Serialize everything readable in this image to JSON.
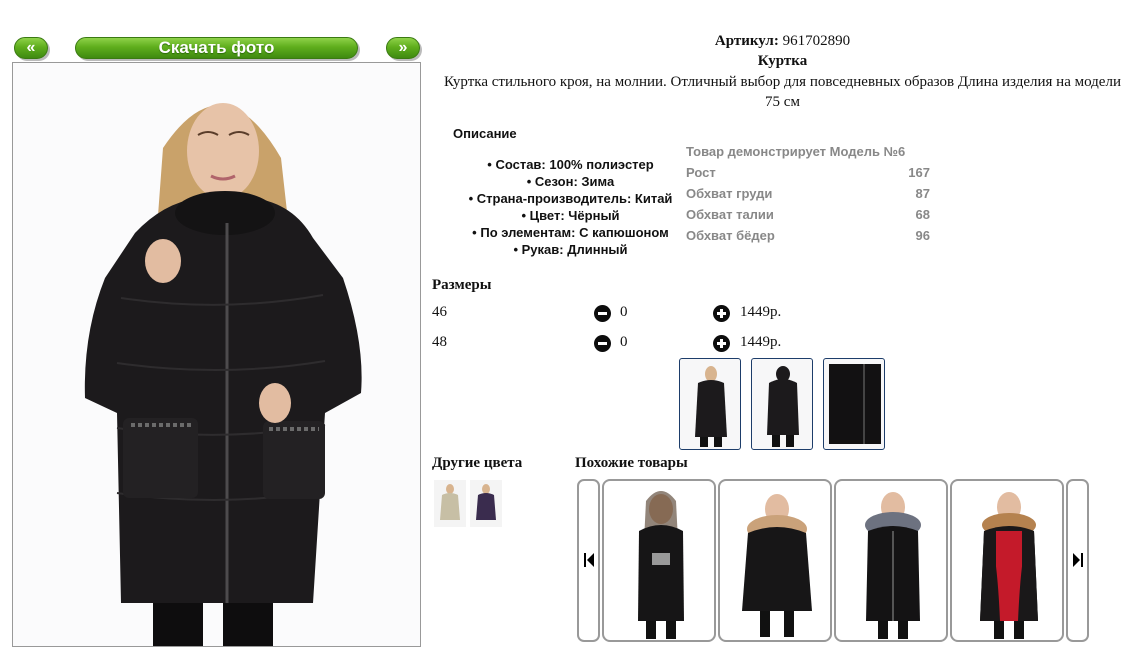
{
  "nav": {
    "prev_label": "«",
    "download_label": "Скачать фото",
    "next_label": "»"
  },
  "product": {
    "article_label": "Артикул:",
    "article_value": "961702890",
    "title": "Куртка",
    "description": "Куртка стильного кроя, на молнии. Отличный выбор для повседневных образов Длина изделия на модели 75 см"
  },
  "specs": {
    "heading": "Описание",
    "items": [
      "Состав: 100% полиэстер",
      "Сезон: Зима",
      "Страна-производитель: Китай",
      "Цвет: Чёрный",
      "По элементам: С капюшоном",
      "Рукав: Длинный"
    ]
  },
  "model": {
    "heading": "Товар демонстрирует Модель №6",
    "rows": [
      {
        "label": "Рост",
        "value": "167"
      },
      {
        "label": "Обхват груди",
        "value": "87"
      },
      {
        "label": "Обхват талии",
        "value": "68"
      },
      {
        "label": "Обхват бёдер",
        "value": "96"
      }
    ]
  },
  "sizes": {
    "heading": "Размеры",
    "rows": [
      {
        "size": "46",
        "qty": "0",
        "price": "1449р."
      },
      {
        "size": "48",
        "qty": "0",
        "price": "1449р."
      }
    ]
  },
  "other_colors": {
    "heading": "Другие цвета"
  },
  "similar": {
    "heading": "Похожие товары"
  },
  "colors": {
    "jacket": "#1c1a1c",
    "button_green": "#5fae1d",
    "thumb_border": "#1d3d6a",
    "model_text": "#888888"
  },
  "icons": {
    "prev": "double-chevron-left-icon",
    "next": "double-chevron-right-icon",
    "minus": "minus-circle-icon",
    "plus": "plus-circle-icon",
    "carousel_prev": "skip-back-icon",
    "carousel_next": "skip-forward-icon"
  }
}
